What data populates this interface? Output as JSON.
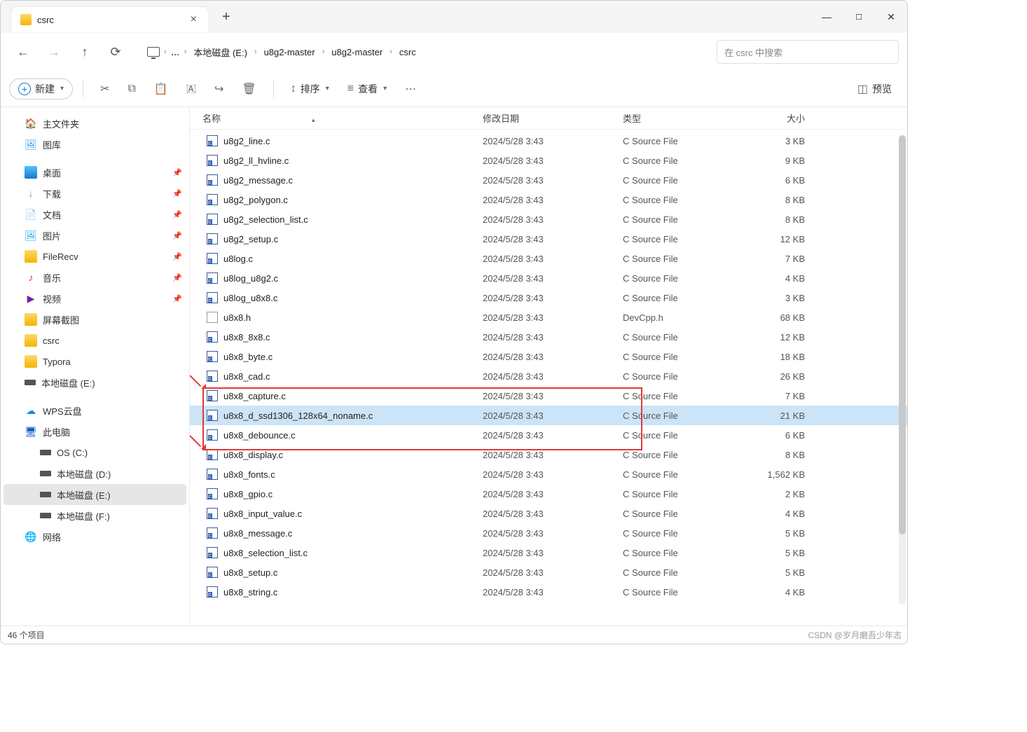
{
  "tab": {
    "title": "csrc"
  },
  "breadcrumb": [
    "本地磁盘 (E:)",
    "u8g2-master",
    "u8g2-master",
    "csrc"
  ],
  "search_placeholder": "在 csrc 中搜索",
  "toolbar": {
    "new": "新建",
    "sort": "排序",
    "view": "查看",
    "preview": "预览"
  },
  "sidebar": {
    "home": "主文件夹",
    "gallery": "图库",
    "quick": [
      {
        "icon": "desktop",
        "label": "桌面",
        "pin": true
      },
      {
        "icon": "dl",
        "label": "下载",
        "pin": true
      },
      {
        "icon": "doc",
        "label": "文档",
        "pin": true
      },
      {
        "icon": "pic",
        "label": "图片",
        "pin": true
      },
      {
        "icon": "folder",
        "label": "FileRecv",
        "pin": true
      },
      {
        "icon": "music",
        "label": "音乐",
        "pin": true
      },
      {
        "icon": "video",
        "label": "视频",
        "pin": true
      },
      {
        "icon": "folder",
        "label": "屏幕截图",
        "pin": false
      },
      {
        "icon": "folder",
        "label": "csrc",
        "pin": false
      },
      {
        "icon": "folder",
        "label": "Typora",
        "pin": false
      },
      {
        "icon": "drive",
        "label": "本地磁盘 (E:)",
        "pin": false
      }
    ],
    "wps": "WPS云盘",
    "pc": "此电脑",
    "drives": [
      "OS (C:)",
      "本地磁盘 (D:)",
      "本地磁盘 (E:)",
      "本地磁盘 (F:)"
    ],
    "network": "网络"
  },
  "columns": {
    "name": "名称",
    "date": "修改日期",
    "type": "类型",
    "size": "大小"
  },
  "files": [
    {
      "n": "u8g2_line.c",
      "d": "2024/5/28 3:43",
      "t": "C Source File",
      "s": "3 KB",
      "ext": "c"
    },
    {
      "n": "u8g2_ll_hvline.c",
      "d": "2024/5/28 3:43",
      "t": "C Source File",
      "s": "9 KB",
      "ext": "c"
    },
    {
      "n": "u8g2_message.c",
      "d": "2024/5/28 3:43",
      "t": "C Source File",
      "s": "6 KB",
      "ext": "c"
    },
    {
      "n": "u8g2_polygon.c",
      "d": "2024/5/28 3:43",
      "t": "C Source File",
      "s": "8 KB",
      "ext": "c"
    },
    {
      "n": "u8g2_selection_list.c",
      "d": "2024/5/28 3:43",
      "t": "C Source File",
      "s": "8 KB",
      "ext": "c"
    },
    {
      "n": "u8g2_setup.c",
      "d": "2024/5/28 3:43",
      "t": "C Source File",
      "s": "12 KB",
      "ext": "c"
    },
    {
      "n": "u8log.c",
      "d": "2024/5/28 3:43",
      "t": "C Source File",
      "s": "7 KB",
      "ext": "c"
    },
    {
      "n": "u8log_u8g2.c",
      "d": "2024/5/28 3:43",
      "t": "C Source File",
      "s": "4 KB",
      "ext": "c"
    },
    {
      "n": "u8log_u8x8.c",
      "d": "2024/5/28 3:43",
      "t": "C Source File",
      "s": "3 KB",
      "ext": "c"
    },
    {
      "n": "u8x8.h",
      "d": "2024/5/28 3:43",
      "t": "DevCpp.h",
      "s": "68 KB",
      "ext": "h"
    },
    {
      "n": "u8x8_8x8.c",
      "d": "2024/5/28 3:43",
      "t": "C Source File",
      "s": "12 KB",
      "ext": "c"
    },
    {
      "n": "u8x8_byte.c",
      "d": "2024/5/28 3:43",
      "t": "C Source File",
      "s": "18 KB",
      "ext": "c"
    },
    {
      "n": "u8x8_cad.c",
      "d": "2024/5/28 3:43",
      "t": "C Source File",
      "s": "26 KB",
      "ext": "c"
    },
    {
      "n": "u8x8_capture.c",
      "d": "2024/5/28 3:43",
      "t": "C Source File",
      "s": "7 KB",
      "ext": "c"
    },
    {
      "n": "u8x8_d_ssd1306_128x64_noname.c",
      "d": "2024/5/28 3:43",
      "t": "C Source File",
      "s": "21 KB",
      "ext": "c",
      "sel": true
    },
    {
      "n": "u8x8_debounce.c",
      "d": "2024/5/28 3:43",
      "t": "C Source File",
      "s": "6 KB",
      "ext": "c"
    },
    {
      "n": "u8x8_display.c",
      "d": "2024/5/28 3:43",
      "t": "C Source File",
      "s": "8 KB",
      "ext": "c"
    },
    {
      "n": "u8x8_fonts.c",
      "d": "2024/5/28 3:43",
      "t": "C Source File",
      "s": "1,562 KB",
      "ext": "c"
    },
    {
      "n": "u8x8_gpio.c",
      "d": "2024/5/28 3:43",
      "t": "C Source File",
      "s": "2 KB",
      "ext": "c"
    },
    {
      "n": "u8x8_input_value.c",
      "d": "2024/5/28 3:43",
      "t": "C Source File",
      "s": "4 KB",
      "ext": "c"
    },
    {
      "n": "u8x8_message.c",
      "d": "2024/5/28 3:43",
      "t": "C Source File",
      "s": "5 KB",
      "ext": "c"
    },
    {
      "n": "u8x8_selection_list.c",
      "d": "2024/5/28 3:43",
      "t": "C Source File",
      "s": "5 KB",
      "ext": "c"
    },
    {
      "n": "u8x8_setup.c",
      "d": "2024/5/28 3:43",
      "t": "C Source File",
      "s": "5 KB",
      "ext": "c"
    },
    {
      "n": "u8x8_string.c",
      "d": "2024/5/28 3:43",
      "t": "C Source File",
      "s": "4 KB",
      "ext": "c"
    }
  ],
  "status": "46 个项目",
  "watermark": "CSDN @岁月磨吾少年志"
}
